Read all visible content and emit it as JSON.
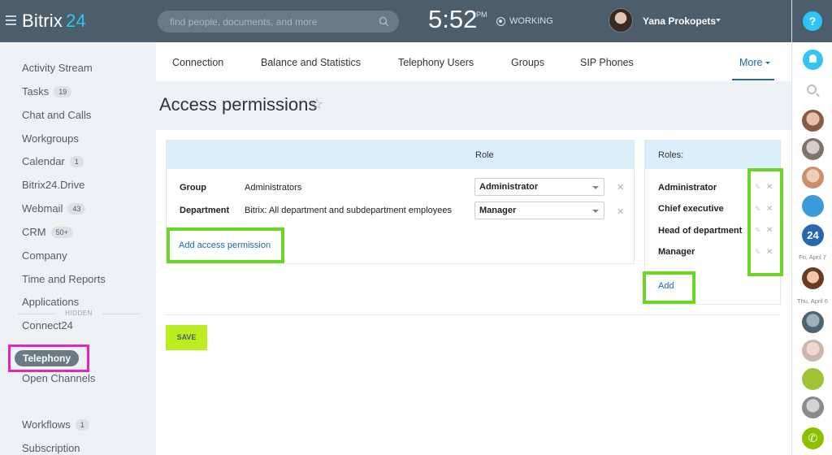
{
  "header": {
    "logo_text": "Bitrix",
    "logo_num": "24",
    "search_placeholder": "find people, documents, and more",
    "clock": "5:52",
    "ampm": "PM",
    "status": "WORKING",
    "user_name": "Yana Prokopets"
  },
  "sidebar": {
    "items": [
      {
        "label": "Activity Stream",
        "count": ""
      },
      {
        "label": "Tasks",
        "count": "19"
      },
      {
        "label": "Chat and Calls",
        "count": ""
      },
      {
        "label": "Workgroups",
        "count": ""
      },
      {
        "label": "Calendar",
        "count": "1"
      },
      {
        "label": "Bitrix24.Drive",
        "count": ""
      },
      {
        "label": "Webmail",
        "count": "43"
      },
      {
        "label": "CRM",
        "count": "50+"
      },
      {
        "label": "Company",
        "count": ""
      },
      {
        "label": "Time and Reports",
        "count": ""
      },
      {
        "label": "Applications",
        "count": ""
      },
      {
        "label": "Connect24",
        "count": ""
      }
    ],
    "hidden_label": "HIDDEN",
    "hidden_items": [
      {
        "label": "Open Channels",
        "count": ""
      },
      {
        "label": "Telephony",
        "count": ""
      },
      {
        "label": "Workflows",
        "count": "1"
      },
      {
        "label": "Subscription",
        "count": ""
      }
    ]
  },
  "tabs": [
    "Connection",
    "Balance and Statistics",
    "Telephony Users",
    "Groups",
    "SIP Phones",
    "More"
  ],
  "page": {
    "title": "Access permissions",
    "role_column": "Role",
    "rows": [
      {
        "type": "Group",
        "value": "Administrators",
        "role": "Administrator"
      },
      {
        "type": "Department",
        "value": "Bitrix: All department and subdepartment employees",
        "role": "Manager"
      }
    ],
    "add_permission": "Add access permission",
    "save": "SAVE"
  },
  "roles": {
    "title": "Roles:",
    "items": [
      "Administrator",
      "Chief executive",
      "Head of department",
      "Manager"
    ],
    "add": "Add"
  },
  "right_panel": {
    "help": "?",
    "badge_24": "24",
    "date1": "Fri, April 7",
    "date2": "Thu, April 6"
  },
  "colors": {
    "topbar": "#4c5d6b",
    "accent": "#2fc6f6",
    "link": "#2067b0",
    "save": "#bbed21",
    "highlight_green": "#69d628",
    "highlight_magenta": "#e027c1"
  }
}
